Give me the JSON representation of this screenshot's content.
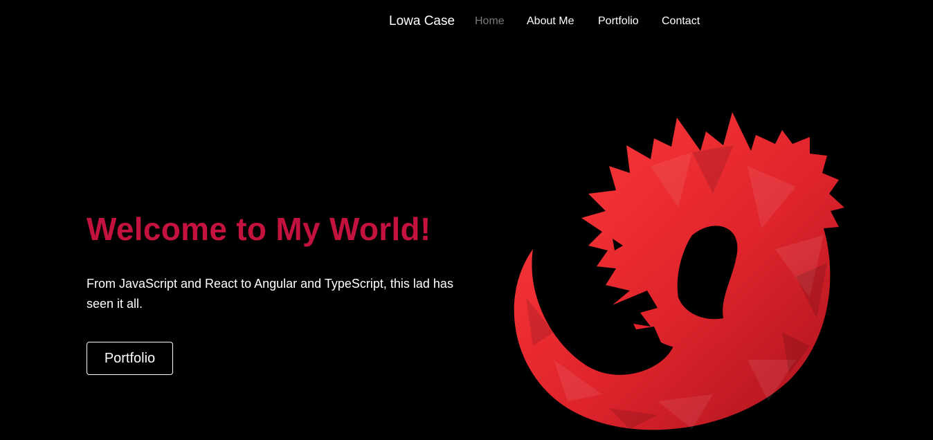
{
  "nav": {
    "brand": "Lowa Case",
    "links": [
      {
        "label": "Home",
        "active": true
      },
      {
        "label": "About Me",
        "active": false
      },
      {
        "label": "Portfolio",
        "active": false
      },
      {
        "label": "Contact",
        "active": false
      }
    ]
  },
  "hero": {
    "title": "Welcome to My World!",
    "subtitle": "From JavaScript and React to Angular and TypeScript, this lad has seen it all.",
    "button_label": "Portfolio",
    "image_icon": "dragon-logo-icon"
  },
  "colors": {
    "background": "#000000",
    "title": "#c4123f",
    "text": "#ffffff",
    "nav_active": "#7a7a7a",
    "dragon_red": "#e0242c",
    "dragon_dark": "#a8121c",
    "dragon_light": "#ff3b3b"
  }
}
